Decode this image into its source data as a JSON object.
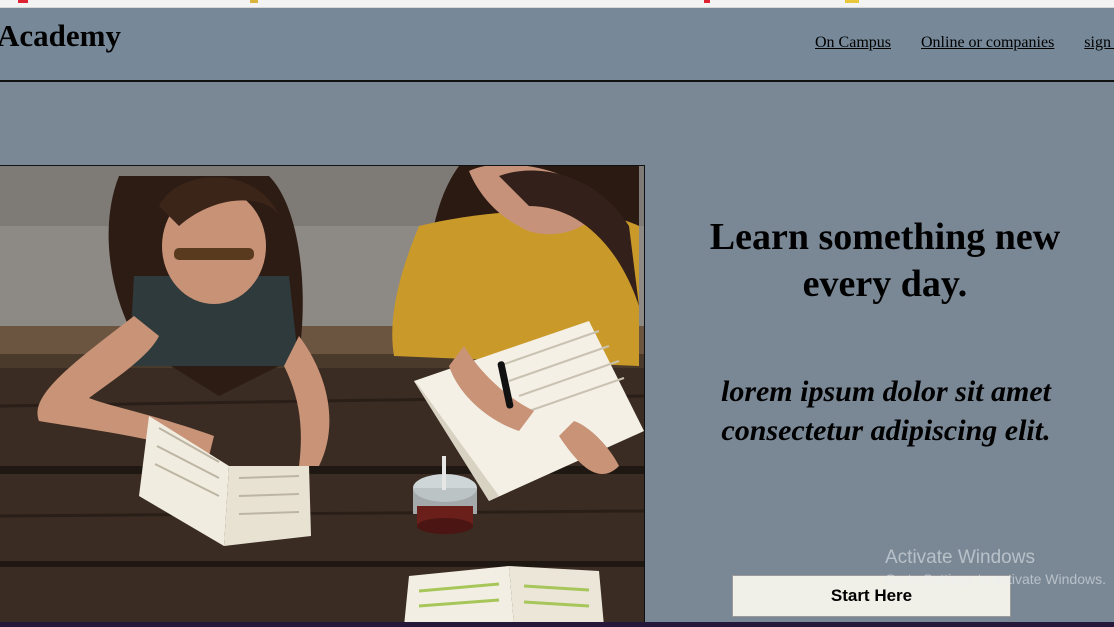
{
  "header": {
    "brand": "Academy",
    "nav": [
      {
        "label": "On Campus"
      },
      {
        "label": "Online or companies"
      },
      {
        "label": "sign in"
      }
    ]
  },
  "hero": {
    "photo_alt": "students-studying-photo",
    "headline": "Learn something new every day.",
    "tagline": "lorem ipsum dolor sit amet consectetur adipiscing elit.",
    "cta": "Start Here"
  },
  "overlay": {
    "activate_title": "Activate Windows",
    "activate_sub": "Go to Settings to activate Windows."
  },
  "colors": {
    "page_bg": "#7a8896",
    "navbar_bg": "#778999",
    "button_bg": "#f0efe8"
  }
}
